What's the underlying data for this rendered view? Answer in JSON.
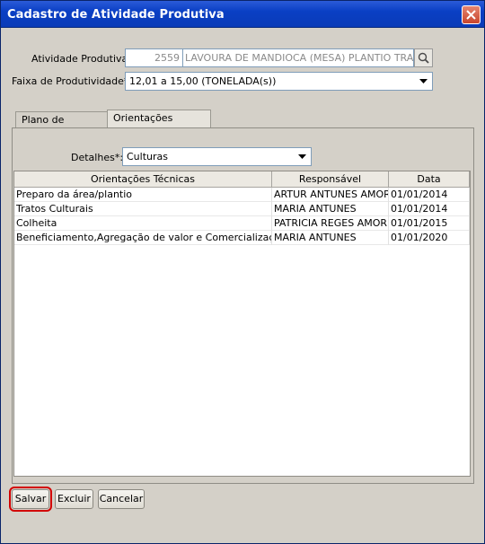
{
  "window": {
    "title": "Cadastro de Atividade Produtiva"
  },
  "form": {
    "atividade_label": "Atividade Produtiva:",
    "atividade_code": "2559",
    "atividade_desc": "LAVOURA DE MANDIOCA (MESA) PLANTIO TRADICIONA",
    "faixa_label": "Faixa de Produtividade*:",
    "faixa_value": "12,01 a 15,00 (TONELADA(s))"
  },
  "tabs": [
    {
      "label": "Plano de Produção"
    },
    {
      "label": "Orientações Técnicas"
    }
  ],
  "detalhes": {
    "label": "Detalhes*:",
    "value": "Culturas"
  },
  "table": {
    "headers": [
      "Orientações Técnicas",
      "Responsável",
      "Data"
    ],
    "rows": [
      [
        "Preparo da área/plantio",
        "ARTUR ANTUNES AMORIM",
        "01/01/2014"
      ],
      [
        "Tratos Culturais",
        "MARIA ANTUNES",
        "01/01/2014"
      ],
      [
        "Colheita",
        "PATRICIA REGES AMORIM",
        "01/01/2015"
      ],
      [
        "Beneficiamento,Agregação de valor e Comercialização",
        "MARIA ANTUNES",
        "01/01/2020"
      ]
    ]
  },
  "buttons": {
    "save": "Salvar",
    "delete": "Excluir",
    "cancel": "Cancelar"
  },
  "icons": {
    "close": "close-icon",
    "search": "search-icon",
    "dropdown": "chevron-down-icon"
  }
}
